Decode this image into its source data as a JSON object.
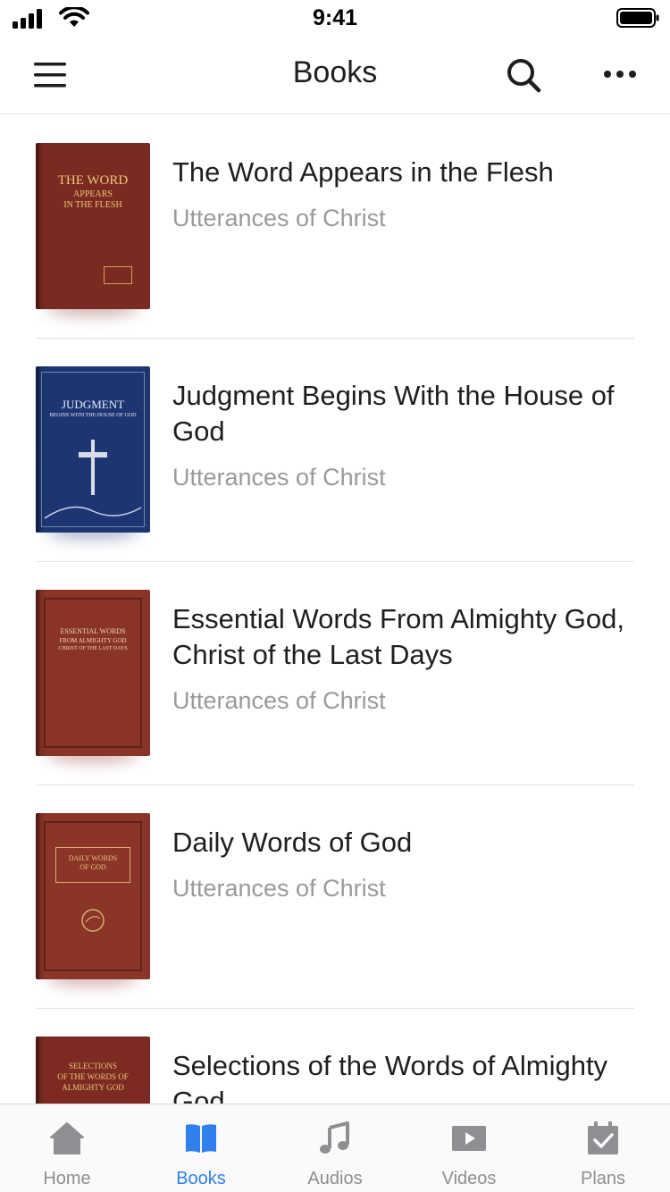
{
  "status_bar": {
    "time": "9:41"
  },
  "nav": {
    "title": "Books",
    "menu_icon": "hamburger-menu-icon",
    "search_icon": "search-icon",
    "more_icon": "ellipsis-icon"
  },
  "books": [
    {
      "title": "The Word Appears in the Flesh",
      "subtitle": "Utterances of Christ",
      "cover_color": "#7b2a22",
      "cover_text": [
        "THE WORD",
        "APPEARS",
        "IN THE FLESH"
      ]
    },
    {
      "title": "Judgment Begins With the House of God",
      "subtitle": "Utterances of Christ",
      "cover_color": "#1d3673",
      "cover_text": [
        "JUDGMENT",
        "BEGINS WITH THE HOUSE OF GOD"
      ]
    },
    {
      "title": "Essential Words From Almighty God, Christ of the Last Days",
      "subtitle": "Utterances of Christ",
      "cover_color": "#8a3327",
      "cover_text": [
        "ESSENTIAL WORDS",
        "FROM ALMIGHTY GOD",
        "CHRIST OF THE LAST DAYS"
      ]
    },
    {
      "title": "Daily Words of God",
      "subtitle": "Utterances of Christ",
      "cover_color": "#8b3428",
      "cover_text": [
        "DAILY WORDS",
        "OF GOD"
      ]
    },
    {
      "title": "Selections of the Words of Almighty God",
      "subtitle": "",
      "cover_color": "#7d2a22",
      "cover_text": [
        "SELECTIONS",
        "OF THE WORDS OF",
        "ALMIGHTY GOD"
      ]
    }
  ],
  "tabs": [
    {
      "label": "Home",
      "icon": "home-icon",
      "active": false
    },
    {
      "label": "Books",
      "icon": "book-icon",
      "active": true
    },
    {
      "label": "Audios",
      "icon": "music-note-icon",
      "active": false
    },
    {
      "label": "Videos",
      "icon": "play-icon",
      "active": false
    },
    {
      "label": "Plans",
      "icon": "calendar-check-icon",
      "active": false
    }
  ],
  "colors": {
    "accent": "#2f80ed",
    "inactive": "#8e8e93",
    "subtitle": "#9a9a9e"
  }
}
